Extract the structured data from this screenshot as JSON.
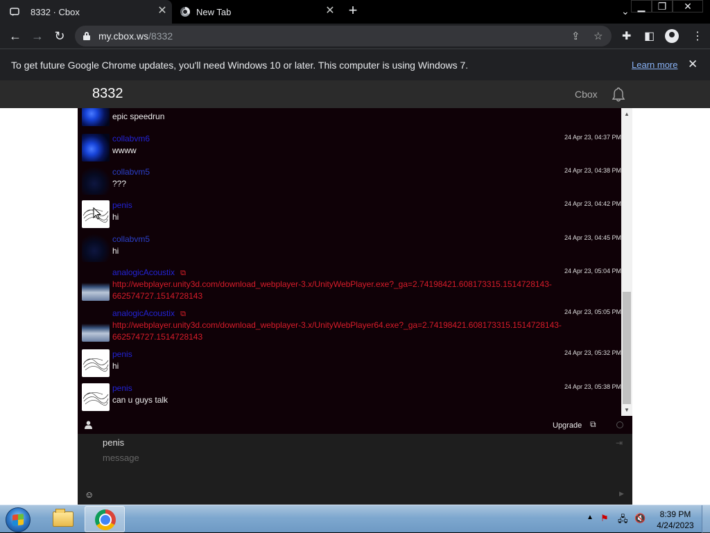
{
  "browser": {
    "tabs": [
      {
        "title": "8332 · Cbox",
        "active": true
      },
      {
        "title": "New Tab",
        "active": false
      }
    ],
    "new_tab_symbol": "+",
    "url_host": "my.cbox.ws",
    "url_path": "/8332",
    "infobar": {
      "message": "To get future Google Chrome updates, you'll need Windows 10 or later. This computer is using Windows 7.",
      "learn_more": "Learn more"
    }
  },
  "site": {
    "box_name": "8332",
    "brand": "Cbox"
  },
  "messages": [
    {
      "avatar": "blue",
      "name": "",
      "time": "",
      "text": "epic speedrun",
      "link": ""
    },
    {
      "avatar": "blue",
      "name": "collabvm6",
      "time": "24 Apr 23, 04:37 PM",
      "text": "wwww",
      "link": ""
    },
    {
      "avatar": "dark",
      "name": "collabvm5",
      "time": "24 Apr 23, 04:38 PM",
      "text": "???",
      "link": ""
    },
    {
      "avatar": "sketch",
      "name": "penis",
      "time": "24 Apr 23, 04:42 PM",
      "text": "hi",
      "link": ""
    },
    {
      "avatar": "dark",
      "name": "collabvm5",
      "time": "24 Apr 23, 04:45 PM",
      "text": "hi",
      "link": ""
    },
    {
      "avatar": "earth",
      "name": "analogicAcoustix",
      "time": "24 Apr 23, 05:04 PM",
      "text": "",
      "link": "http://webplayer.unity3d.com/download_webplayer-3.x/UnityWebPlayer.exe?_ga=2.74198421.608173315.1514728143-662574727.1514728143"
    },
    {
      "avatar": "earth",
      "name": "analogicAcoustix",
      "time": "24 Apr 23, 05:05 PM",
      "text": "",
      "link": "http://webplayer.unity3d.com/download_webplayer-3.x/UnityWebPlayer64.exe?_ga=2.74198421.608173315.1514728143-662574727.1514728143"
    },
    {
      "avatar": "sketch",
      "name": "penis",
      "time": "24 Apr 23, 05:32 PM",
      "text": "hi",
      "link": ""
    },
    {
      "avatar": "sketch",
      "name": "penis",
      "time": "24 Apr 23, 05:38 PM",
      "text": "can u guys talk",
      "link": ""
    }
  ],
  "chatbar": {
    "upgrade": "Upgrade"
  },
  "composer": {
    "name_value": "penis",
    "message_placeholder": "message"
  },
  "taskbar": {
    "time": "8:39 PM",
    "date": "4/24/2023"
  },
  "icons": [
    "lock-icon",
    "share-icon",
    "star-icon",
    "extensions-icon",
    "sidepanel-icon",
    "profile-icon",
    "menu-icon",
    "bell-icon",
    "user-icon",
    "popout-icon",
    "login-icon",
    "emoji-icon",
    "send-icon"
  ]
}
